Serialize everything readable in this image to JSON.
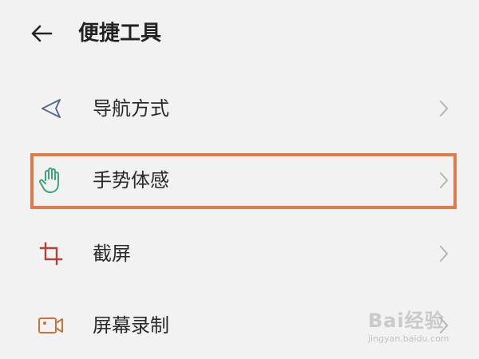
{
  "header": {
    "title": "便捷工具",
    "back_icon": "arrow-left-icon"
  },
  "items": [
    {
      "label": "导航方式",
      "icon": "navigation-arrow-icon",
      "icon_color": "#5b6b8a"
    },
    {
      "label": "手势体感",
      "icon": "hand-gesture-icon",
      "icon_color": "#3aa57a",
      "highlighted": true
    },
    {
      "label": "截屏",
      "icon": "crop-screenshot-icon",
      "icon_color": "#b0433a"
    },
    {
      "label": "屏幕录制",
      "icon": "video-record-icon",
      "icon_color": "#c9733a"
    }
  ],
  "watermark": {
    "brand": "Bai经验",
    "url": "jingyan.baidu.com"
  },
  "colors": {
    "background": "#f2f2f2",
    "highlight_border": "#e07a4a",
    "chevron": "#b5b5b5"
  }
}
